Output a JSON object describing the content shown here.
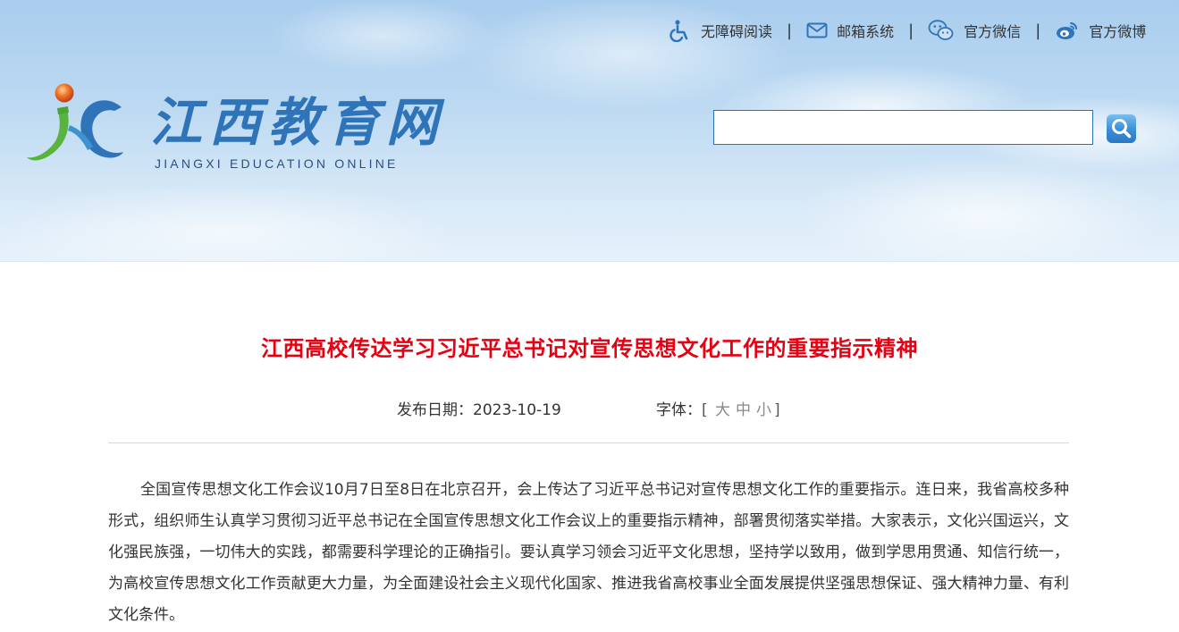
{
  "header": {
    "top_links": [
      {
        "label": "无障碍阅读",
        "icon": "accessibility-icon"
      },
      {
        "label": "邮箱系统",
        "icon": "mail-icon"
      },
      {
        "label": "官方微信",
        "icon": "wechat-icon"
      },
      {
        "label": "官方微博",
        "icon": "weibo-icon"
      }
    ],
    "separator": "|",
    "logo": {
      "cn": "江西教育网",
      "en": "JIANGXI EDUCATION ONLINE"
    },
    "search": {
      "value": "",
      "placeholder": ""
    }
  },
  "article": {
    "title": "江西高校传达学习习近平总书记对宣传思想文化工作的重要指示精神",
    "date_label": "发布日期：2023-10-19",
    "font_label": "字体：",
    "font_open": "[",
    "font_close": "]",
    "font_sizes": [
      "大",
      "中",
      "小"
    ],
    "body": "全国宣传思想文化工作会议10月7日至8日在北京召开，会上传达了习近平总书记对宣传思想文化工作的重要指示。连日来，我省高校多种形式，组织师生认真学习贯彻习近平总书记在全国宣传思想文化工作会议上的重要指示精神，部署贯彻落实举措。大家表示，文化兴国运兴，文化强民族强，一切伟大的实践，都需要科学理论的正确指引。要认真学习领会习近平文化思想，坚持学以致用，做到学思用贯通、知信行统一，为高校宣传思想文化工作贡献更大力量，为全面建设社会主义现代化国家、推进我省高校事业全面发展提供坚强思想保证、强大精神力量、有利文化条件。"
  },
  "colors": {
    "title_red": "#e60012",
    "link_blue": "#2f74b9",
    "text": "#333333"
  }
}
